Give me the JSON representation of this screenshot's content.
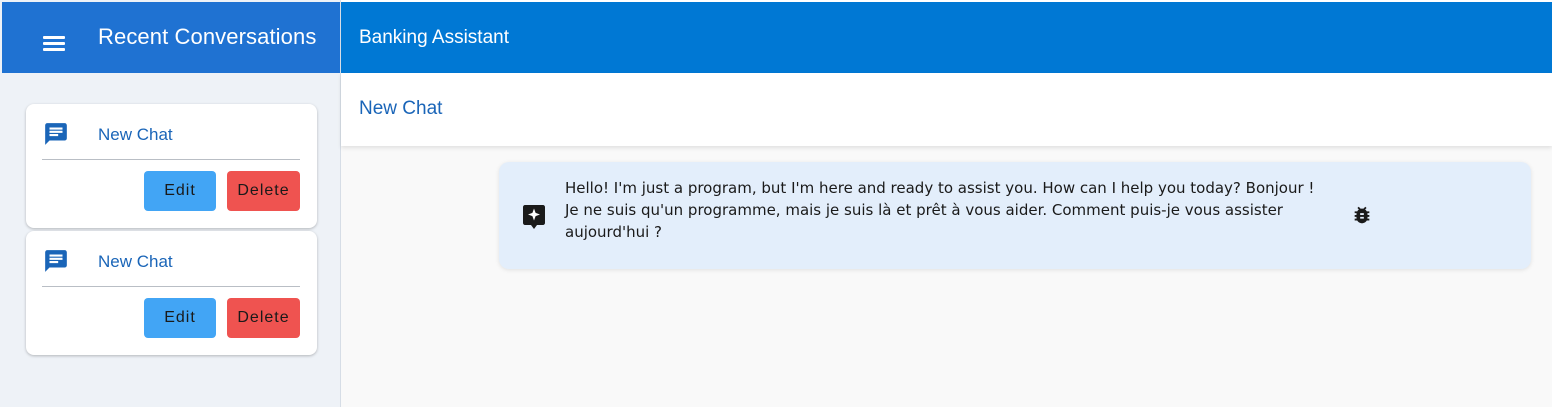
{
  "sidebar": {
    "title": "Recent Conversations",
    "menu_icon": "hamburger-menu-icon",
    "conversations": [
      {
        "label": "New Chat",
        "icon": "chat-bubble-icon",
        "edit_label": "Edit",
        "delete_label": "Delete"
      },
      {
        "label": "New Chat",
        "icon": "chat-bubble-icon",
        "edit_label": "Edit",
        "delete_label": "Delete"
      }
    ]
  },
  "topbar": {
    "title": "Banking Assistant"
  },
  "chat": {
    "title": "New Chat",
    "messages": [
      {
        "icon": "assistant-sparkle-icon",
        "lines": [
          "Hello! I'm just a program, but I'm here and ready to assist you. How can I help you today? Bonjour !",
          "Je ne suis qu'un programme, mais je suis là et prêt à vous aider. Comment puis-je vous assister",
          "aujourd'hui ?"
        ],
        "action_icon": "bug-icon"
      }
    ]
  },
  "colors": {
    "sidebar_header": "#1f72d2",
    "topbar": "#0078d4",
    "sidebar_bg": "#eef2f7",
    "edit_button": "#42a5f5",
    "delete_button": "#ef5350",
    "message_bg": "#e3eefb",
    "link_text": "#1a65b8"
  }
}
